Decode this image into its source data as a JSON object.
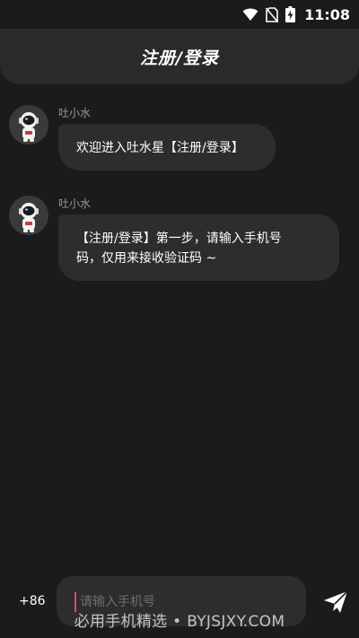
{
  "status_bar": {
    "time": "11:08",
    "icons": [
      "wifi-icon",
      "no-sim-icon",
      "battery-charging-icon"
    ]
  },
  "header": {
    "title": "注册/登录"
  },
  "messages": [
    {
      "sender": "吐小水",
      "avatar": "astronaut-avatar",
      "text_lines": [
        "欢迎进入吐水星【注册/登录】"
      ]
    },
    {
      "sender": "吐小水",
      "avatar": "astronaut-avatar",
      "text_lines": [
        "【注册/登录】第一步，请输入手机号",
        "码，仅用来接收验证码 ~"
      ]
    }
  ],
  "input_bar": {
    "country_code": "+86",
    "phone_placeholder": "请输入手机号",
    "phone_value": "",
    "send_icon": "send-icon"
  },
  "watermark": "必用手机精选 • BYJSJXY.COM",
  "colors": {
    "background": "#1b1b1b",
    "surface": "#2a2a2a",
    "bubble": "#2d2d2d",
    "caret": "#e0457b",
    "secondary_text": "#9a9a9a"
  }
}
